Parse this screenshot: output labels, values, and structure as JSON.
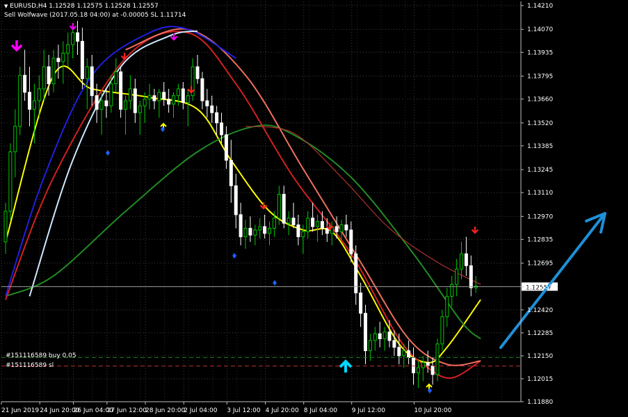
{
  "header": {
    "symbol_line": "EURUSD,H4  1.12528 1.12575 1.12528 1.12557",
    "indicator_line": "Sell Wolfwave (2017.05.18 04:00) at -0.00005 SL 1.11714"
  },
  "orders": {
    "buy_label": "#151116589 buy 0.05",
    "sl_label": "#151116589 sl"
  },
  "current_price_label": "1.12557",
  "colors": {
    "background": "#000000",
    "grid": "#404040",
    "bull_candle": "#00c800",
    "bear_candle": "#ffffff",
    "yellow_ma": "#ffff00",
    "green_ma": "#228b22",
    "red_ma": "#d42020",
    "salmon_ma": "#f07060",
    "darkred_ma": "#b03030",
    "blue_ma": "#2020e0",
    "lightblue_ma": "#d0e8ff",
    "arrow_annotation": "#1e90d8",
    "buy_line": "#208020",
    "sl_line": "#c03030"
  },
  "chart_data": {
    "type": "candlestick",
    "symbol": "EURUSD",
    "timeframe": "H4",
    "ylim": [
      1.1188,
      1.1421
    ],
    "y_ticks": [
      "1.14210",
      "1.14070",
      "1.13935",
      "1.13795",
      "1.13660",
      "1.13520",
      "1.13385",
      "1.13245",
      "1.13110",
      "1.12970",
      "1.12835",
      "1.12695",
      "1.12555",
      "1.12420",
      "1.12285",
      "1.12150",
      "1.12015",
      "1.11880"
    ],
    "x_ticks": [
      "21 Jun 2019",
      "24 Jun 20:00",
      "26 Jun 04:00",
      "27 Jun 12:00",
      "28 Jun 20:00",
      "2 Jul 04:00",
      "3 Jul 12:00",
      "4 Jul 20:00",
      "8 Jul 04:00",
      "9 Jul 12:00",
      "10 Jul 20:00"
    ],
    "last_price": 1.12557,
    "order_levels": {
      "buy": 1.1214,
      "sl": 1.1209
    },
    "candles": [
      [
        1.1282,
        1.1305,
        1.1275,
        1.13
      ],
      [
        1.13,
        1.134,
        1.1295,
        1.1335
      ],
      [
        1.1335,
        1.136,
        1.132,
        1.135
      ],
      [
        1.135,
        1.1385,
        1.1345,
        1.138
      ],
      [
        1.138,
        1.1395,
        1.1365,
        1.137
      ],
      [
        1.137,
        1.1385,
        1.135,
        1.136
      ],
      [
        1.136,
        1.1375,
        1.134,
        1.1365
      ],
      [
        1.1365,
        1.138,
        1.1355,
        1.1372
      ],
      [
        1.1372,
        1.1395,
        1.1365,
        1.1385
      ],
      [
        1.1385,
        1.1392,
        1.1368,
        1.1375
      ],
      [
        1.1375,
        1.1395,
        1.137,
        1.139
      ],
      [
        1.139,
        1.1398,
        1.1378,
        1.1388
      ],
      [
        1.1388,
        1.14,
        1.1375,
        1.1393
      ],
      [
        1.1393,
        1.1405,
        1.1385,
        1.1398
      ],
      [
        1.1398,
        1.141,
        1.139,
        1.1405
      ],
      [
        1.1405,
        1.1412,
        1.1392,
        1.14
      ],
      [
        1.14,
        1.1408,
        1.1372,
        1.1378
      ],
      [
        1.1378,
        1.139,
        1.136,
        1.1385
      ],
      [
        1.1385,
        1.1392,
        1.1362,
        1.1368
      ],
      [
        1.1368,
        1.1375,
        1.1352,
        1.136
      ],
      [
        1.136,
        1.137,
        1.1345,
        1.1365
      ],
      [
        1.1365,
        1.1372,
        1.1355,
        1.1362
      ],
      [
        1.1362,
        1.138,
        1.1358,
        1.1375
      ],
      [
        1.1375,
        1.139,
        1.137,
        1.1382
      ],
      [
        1.1382,
        1.1385,
        1.1355,
        1.136
      ],
      [
        1.136,
        1.1368,
        1.1345,
        1.1365
      ],
      [
        1.1365,
        1.138,
        1.136,
        1.1372
      ],
      [
        1.1372,
        1.1378,
        1.1352,
        1.1358
      ],
      [
        1.1358,
        1.1365,
        1.1345,
        1.1362
      ],
      [
        1.1362,
        1.137,
        1.1352,
        1.1366
      ],
      [
        1.1366,
        1.1375,
        1.136,
        1.1368
      ],
      [
        1.1368,
        1.1372,
        1.136,
        1.1365
      ],
      [
        1.1365,
        1.1372,
        1.1355,
        1.137
      ],
      [
        1.137,
        1.1376,
        1.1362,
        1.1366
      ],
      [
        1.1366,
        1.1372,
        1.1358,
        1.1363
      ],
      [
        1.1363,
        1.137,
        1.1355,
        1.1368
      ],
      [
        1.1368,
        1.1375,
        1.1362,
        1.1372
      ],
      [
        1.1372,
        1.1376,
        1.136,
        1.1364
      ],
      [
        1.1364,
        1.1372,
        1.135,
        1.1368
      ],
      [
        1.1368,
        1.139,
        1.1365,
        1.1385
      ],
      [
        1.1385,
        1.1392,
        1.1375,
        1.1378
      ],
      [
        1.1378,
        1.1382,
        1.136,
        1.1365
      ],
      [
        1.1365,
        1.1372,
        1.1355,
        1.1362
      ],
      [
        1.1362,
        1.1368,
        1.1352,
        1.1358
      ],
      [
        1.1358,
        1.1362,
        1.1345,
        1.1352
      ],
      [
        1.1352,
        1.1358,
        1.134,
        1.1345
      ],
      [
        1.1345,
        1.135,
        1.1325,
        1.133
      ],
      [
        1.133,
        1.1342,
        1.1305,
        1.1315
      ],
      [
        1.1315,
        1.1322,
        1.129,
        1.1298
      ],
      [
        1.1298,
        1.1305,
        1.128,
        1.1285
      ],
      [
        1.1285,
        1.1295,
        1.1278,
        1.129
      ],
      [
        1.129,
        1.1297,
        1.1282,
        1.1286
      ],
      [
        1.1286,
        1.1292,
        1.128,
        1.1289
      ],
      [
        1.1289,
        1.1296,
        1.1284,
        1.1291
      ],
      [
        1.1291,
        1.1298,
        1.1284,
        1.1287
      ],
      [
        1.1287,
        1.1294,
        1.128,
        1.129
      ],
      [
        1.129,
        1.13,
        1.1285,
        1.1296
      ],
      [
        1.1296,
        1.1315,
        1.1292,
        1.131
      ],
      [
        1.131,
        1.1315,
        1.129,
        1.1293
      ],
      [
        1.1293,
        1.13,
        1.1286,
        1.1296
      ],
      [
        1.1296,
        1.1305,
        1.129,
        1.1292
      ],
      [
        1.1292,
        1.1298,
        1.128,
        1.1285
      ],
      [
        1.1285,
        1.1292,
        1.1275,
        1.1288
      ],
      [
        1.1288,
        1.13,
        1.1284,
        1.1296
      ],
      [
        1.1296,
        1.1305,
        1.1288,
        1.1291
      ],
      [
        1.1291,
        1.1298,
        1.1282,
        1.1294
      ],
      [
        1.1294,
        1.13,
        1.1286,
        1.129
      ],
      [
        1.129,
        1.1296,
        1.1282,
        1.1287
      ],
      [
        1.1287,
        1.1294,
        1.128,
        1.1291
      ],
      [
        1.1291,
        1.1297,
        1.1284,
        1.1288
      ],
      [
        1.1288,
        1.1295,
        1.1283,
        1.1292
      ],
      [
        1.1292,
        1.1298,
        1.1285,
        1.1289
      ],
      [
        1.1289,
        1.1294,
        1.127,
        1.1275
      ],
      [
        1.1275,
        1.128,
        1.1245,
        1.1252
      ],
      [
        1.1252,
        1.1258,
        1.1232,
        1.124
      ],
      [
        1.124,
        1.1245,
        1.121,
        1.1218
      ],
      [
        1.1218,
        1.1228,
        1.1212,
        1.1224
      ],
      [
        1.1224,
        1.1232,
        1.1218,
        1.1228
      ],
      [
        1.1228,
        1.1235,
        1.122,
        1.1225
      ],
      [
        1.1225,
        1.1232,
        1.1218,
        1.1229
      ],
      [
        1.1229,
        1.1236,
        1.122,
        1.1224
      ],
      [
        1.1224,
        1.123,
        1.1215,
        1.122
      ],
      [
        1.122,
        1.1228,
        1.121,
        1.1215
      ],
      [
        1.1215,
        1.1222,
        1.1208,
        1.1218
      ],
      [
        1.1218,
        1.1224,
        1.121,
        1.1214
      ],
      [
        1.1214,
        1.122,
        1.1198,
        1.1205
      ],
      [
        1.1205,
        1.1212,
        1.1196,
        1.1208
      ],
      [
        1.1208,
        1.1215,
        1.12,
        1.1211
      ],
      [
        1.1211,
        1.1218,
        1.1205,
        1.1209
      ],
      [
        1.1209,
        1.1214,
        1.1198,
        1.1204
      ],
      [
        1.1204,
        1.1225,
        1.12,
        1.1222
      ],
      [
        1.1222,
        1.1242,
        1.1218,
        1.1238
      ],
      [
        1.1238,
        1.1255,
        1.1232,
        1.125
      ],
      [
        1.125,
        1.1262,
        1.1244,
        1.1257
      ],
      [
        1.1257,
        1.1272,
        1.125,
        1.1266
      ],
      [
        1.1266,
        1.1282,
        1.126,
        1.1275
      ],
      [
        1.1275,
        1.1285,
        1.1262,
        1.1268
      ],
      [
        1.1268,
        1.1274,
        1.125,
        1.1255
      ],
      [
        1.1255,
        1.1262,
        1.1252,
        1.1256
      ]
    ],
    "moving_averages": [
      {
        "color": "yellow",
        "values": [
          [
            0,
            1.1282
          ],
          [
            10,
            1.138
          ],
          [
            18,
            1.1372
          ],
          [
            30,
            1.1367
          ],
          [
            40,
            1.136
          ],
          [
            47,
            1.133
          ],
          [
            55,
            1.13
          ],
          [
            62,
            1.1289
          ],
          [
            68,
            1.1288
          ],
          [
            74,
            1.1262
          ],
          [
            82,
            1.1222
          ],
          [
            88,
            1.1211
          ],
          [
            92,
            1.122
          ],
          [
            99,
            1.1248
          ]
        ]
      },
      {
        "color": "green",
        "values": [
          [
            0,
            1.125
          ],
          [
            10,
            1.1262
          ],
          [
            25,
            1.13
          ],
          [
            40,
            1.1335
          ],
          [
            52,
            1.135
          ],
          [
            60,
            1.1345
          ],
          [
            72,
            1.132
          ],
          [
            85,
            1.1275
          ],
          [
            95,
            1.1235
          ],
          [
            99,
            1.1225
          ]
        ]
      },
      {
        "color": "red",
        "values": [
          [
            0,
            1.1248
          ],
          [
            10,
            1.132
          ],
          [
            25,
            1.139
          ],
          [
            38,
            1.1405
          ],
          [
            48,
            1.1375
          ],
          [
            60,
            1.132
          ],
          [
            72,
            1.1275
          ],
          [
            82,
            1.1225
          ],
          [
            88,
            1.1208
          ],
          [
            93,
            1.1202
          ],
          [
            99,
            1.1212
          ]
        ]
      },
      {
        "color": "salmon",
        "values": [
          [
            25,
            1.1395
          ],
          [
            38,
            1.1407
          ],
          [
            50,
            1.138
          ],
          [
            62,
            1.1325
          ],
          [
            74,
            1.127
          ],
          [
            84,
            1.1225
          ],
          [
            92,
            1.121
          ],
          [
            99,
            1.1212
          ]
        ]
      },
      {
        "color": "darkred",
        "values": [
          [
            50,
            1.135
          ],
          [
            60,
            1.1346
          ],
          [
            70,
            1.132
          ],
          [
            80,
            1.129
          ],
          [
            90,
            1.127
          ],
          [
            99,
            1.1257
          ]
        ]
      },
      {
        "color": "blue",
        "values": [
          [
            0,
            1.125
          ],
          [
            8,
            1.132
          ],
          [
            18,
            1.138
          ],
          [
            30,
            1.1405
          ],
          [
            38,
            1.1407
          ],
          [
            48,
            1.139
          ]
        ]
      },
      {
        "color": "lightblue",
        "values": [
          [
            5,
            1.125
          ],
          [
            14,
            1.133
          ],
          [
            24,
            1.1385
          ],
          [
            34,
            1.1403
          ],
          [
            40,
            1.1406
          ]
        ]
      }
    ]
  }
}
